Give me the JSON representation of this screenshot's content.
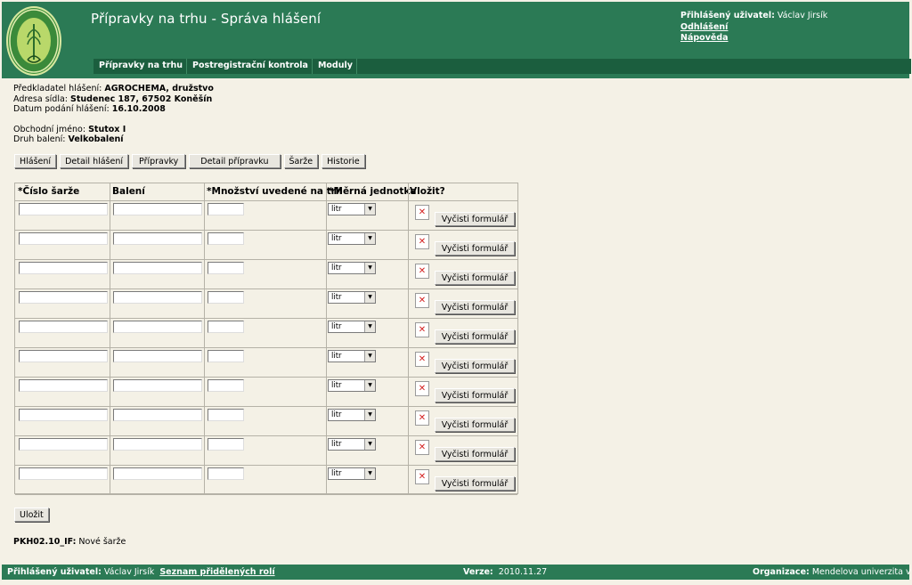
{
  "header": {
    "title": "Přípravky na trhu - Správa hlášení",
    "logo_text": "STÁTNÍ ROSTLINOLÉKAŘSKÁ SPRÁVA",
    "user_label": "Přihlášený uživatel:",
    "user_name": "Václav Jirsík",
    "logout": "Odhlášení",
    "help": "Nápověda"
  },
  "nav": [
    "Přípravky na trhu",
    "Postregistrační kontrola",
    "Moduly"
  ],
  "info": {
    "submitter_label": "Předkladatel hlášení:",
    "submitter": "AGROCHEMA, družstvo",
    "address_label": "Adresa sídla:",
    "address": "Studenec 187, 67502 Koněšín",
    "date_label": "Datum podání hlášení:",
    "date": "16.10.2008",
    "trade_name_label": "Obchodní jméno:",
    "trade_name": "Stutox I",
    "packaging_label": "Druh balení:",
    "packaging": "Velkobalení"
  },
  "tabs": [
    "Hlášení",
    "Detail hlášení",
    "Přípravky",
    "Detail přípravku",
    "Šarže",
    "Historie"
  ],
  "table": {
    "headers": [
      "*Číslo šarže",
      "Balení",
      "*Množství uvedené na trh",
      "*Měrná jednotka",
      "Vložit?"
    ],
    "rows": [
      {
        "unit": "litr",
        "clear": "Vyčisti formulář"
      },
      {
        "unit": "litr",
        "clear": "Vyčisti formulář"
      },
      {
        "unit": "litr",
        "clear": "Vyčisti formulář"
      },
      {
        "unit": "litr",
        "clear": "Vyčisti formulář"
      },
      {
        "unit": "litr",
        "clear": "Vyčisti formulář"
      },
      {
        "unit": "litr",
        "clear": "Vyčisti formulář"
      },
      {
        "unit": "litr",
        "clear": "Vyčisti formulář"
      },
      {
        "unit": "litr",
        "clear": "Vyčisti formulář"
      },
      {
        "unit": "litr",
        "clear": "Vyčisti formulář"
      },
      {
        "unit": "litr",
        "clear": "Vyčisti formulář"
      }
    ]
  },
  "save_label": "Uložit",
  "page_code": "PKH02.10_IF:",
  "page_code_desc": "Nové šarže",
  "footer": {
    "user_label": "Přihlášený uživatel:",
    "user_name": "Václav Jirsík",
    "roles_link": "Seznam přidělených rolí",
    "version_label": "Verze:",
    "version": "2010.11.27",
    "org_label": "Organizace:",
    "org": "Mendelova univerzita v Brně"
  },
  "colors": {
    "header_bg": "#2b7a55",
    "nav_bg": "#1b5e3e",
    "page_bg": "#f4f1e6"
  }
}
